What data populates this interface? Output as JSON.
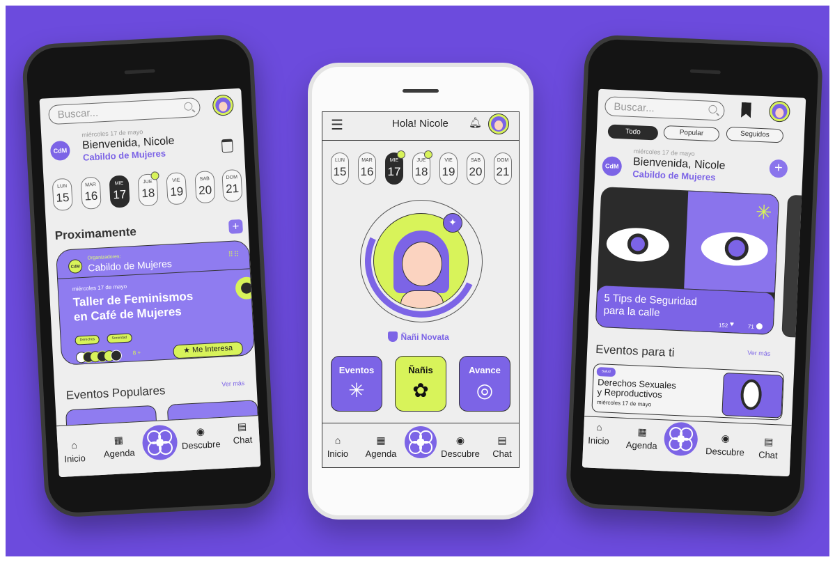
{
  "left_phone": {
    "search": {
      "placeholder": "Buscar..."
    },
    "header": {
      "date": "miércoles 17 de mayo",
      "welcome": "Bienvenida, Nicole",
      "org": "Cabildo de Mujeres",
      "logo": "CdM"
    },
    "days": [
      {
        "name": "LUN",
        "num": "15"
      },
      {
        "name": "MAR",
        "num": "16"
      },
      {
        "name": "MIE",
        "num": "17"
      },
      {
        "name": "JUE",
        "num": "18"
      },
      {
        "name": "VIE",
        "num": "19"
      },
      {
        "name": "SAB",
        "num": "20"
      },
      {
        "name": "DOM",
        "num": "21"
      }
    ],
    "upcoming": {
      "title": "Proximamente",
      "card": {
        "organizers_label": "Organizadores:",
        "organizer": "Cabildo de Mujeres",
        "logo": "CdM",
        "date": "miércoles 17 de mayo",
        "title_line1": "Taller de Feminismos",
        "title_line2": "en Café de Mujeres",
        "tags": [
          "Derechos",
          "Sororidad"
        ],
        "attendees_more": "8 +",
        "interest_button": "Me Interesa"
      }
    },
    "popular": {
      "title": "Eventos Populares",
      "see_more": "Ver más"
    },
    "nav": [
      "Inicio",
      "Agenda",
      "Descubre",
      "Chat"
    ]
  },
  "center_phone": {
    "header": {
      "greeting": "Hola! Nicole"
    },
    "days": [
      {
        "name": "LUN",
        "num": "15"
      },
      {
        "name": "MAR",
        "num": "16"
      },
      {
        "name": "MIE",
        "num": "17"
      },
      {
        "name": "JUE",
        "num": "18"
      },
      {
        "name": "VIE",
        "num": "19"
      },
      {
        "name": "SAB",
        "num": "20"
      },
      {
        "name": "DOM",
        "num": "21"
      }
    ],
    "level": {
      "badge": "Ñañi Novata"
    },
    "tiles": [
      {
        "label": "Eventos",
        "icon": "asterisk-icon"
      },
      {
        "label": "Ñañis",
        "icon": "flower-icon"
      },
      {
        "label": "Avance",
        "icon": "target-icon"
      }
    ],
    "nav": [
      "Inicio",
      "Agenda",
      "Descubre",
      "Chat"
    ]
  },
  "right_phone": {
    "search": {
      "placeholder": "Buscar..."
    },
    "filters": [
      "Todo",
      "Popular",
      "Seguidos"
    ],
    "header": {
      "date": "miércoles 17 de mayo",
      "welcome": "Bienvenida, Nicole",
      "org": "Cabildo de Mujeres",
      "logo": "CdM"
    },
    "feature": {
      "title_line1": "5 Tips de Seguridad",
      "title_line2": "para la calle",
      "likes": "152",
      "comments": "71"
    },
    "events": {
      "title": "Eventos para ti",
      "see_more": "Ver más",
      "item": {
        "tag": "Salud",
        "title_line1": "Derechos Sexuales",
        "title_line2": "y Reproductivos",
        "date": "miércoles 17 de mayo"
      }
    },
    "nav": [
      "Inicio",
      "Agenda",
      "Descubre",
      "Chat"
    ]
  },
  "colors": {
    "background": "#6c4bdd",
    "purple": "#7c64e6",
    "lime": "#d8f35a",
    "dark": "#2b2b2b"
  }
}
